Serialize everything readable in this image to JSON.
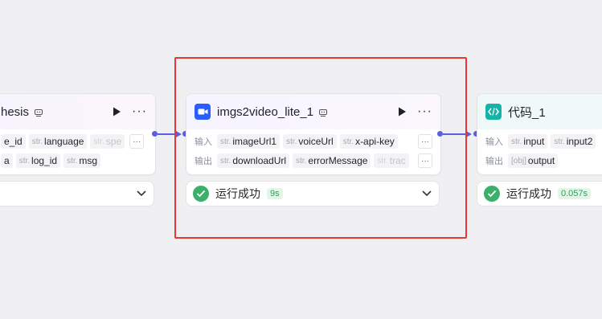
{
  "left_node": {
    "title": "hesis",
    "inputs": [
      {
        "type": "",
        "name": "e_id"
      },
      {
        "type": "str.",
        "name": "language"
      },
      {
        "type": "str.",
        "name": "spe",
        "faded": true
      }
    ],
    "outputs": [
      {
        "type": "",
        "name": "a"
      },
      {
        "type": "str.",
        "name": "log_id"
      },
      {
        "type": "str.",
        "name": "msg"
      }
    ],
    "more_label": "···"
  },
  "middle_node": {
    "title": "imgs2video_lite_1",
    "input_label": "输入",
    "output_label": "输出",
    "inputs": [
      {
        "type": "str.",
        "name": "imageUrl1"
      },
      {
        "type": "str.",
        "name": "voiceUrl"
      },
      {
        "type": "str.",
        "name": "x-api-key"
      }
    ],
    "outputs": [
      {
        "type": "str.",
        "name": "downloadUrl"
      },
      {
        "type": "str.",
        "name": "errorMessage"
      },
      {
        "type": "str.",
        "name": "trac",
        "faded": true
      }
    ],
    "more_label": "···",
    "status": {
      "text": "运行成功",
      "time": "9s"
    }
  },
  "right_node": {
    "title": "代码_1",
    "input_label": "输入",
    "output_label": "输出",
    "inputs": [
      {
        "type": "str.",
        "name": "input"
      },
      {
        "type": "str.",
        "name": "input2"
      }
    ],
    "outputs": [
      {
        "type": "[obj]",
        "name": "output"
      }
    ],
    "status": {
      "text": "运行成功",
      "time": "0.057s"
    }
  },
  "colors": {
    "edge": "#5a5fe0",
    "selection": "#e53935",
    "success": "#3bb06a",
    "video_icon_bg": "#2b5cff",
    "code_icon_bg": "#16b3a8"
  },
  "icons": {
    "video": "video-camera-icon",
    "code": "code-brackets-icon",
    "flag": "robot-flag-icon",
    "play": "play-icon",
    "more": "more-dots-icon",
    "check": "check-circle-icon",
    "chevron": "chevron-down-icon"
  }
}
